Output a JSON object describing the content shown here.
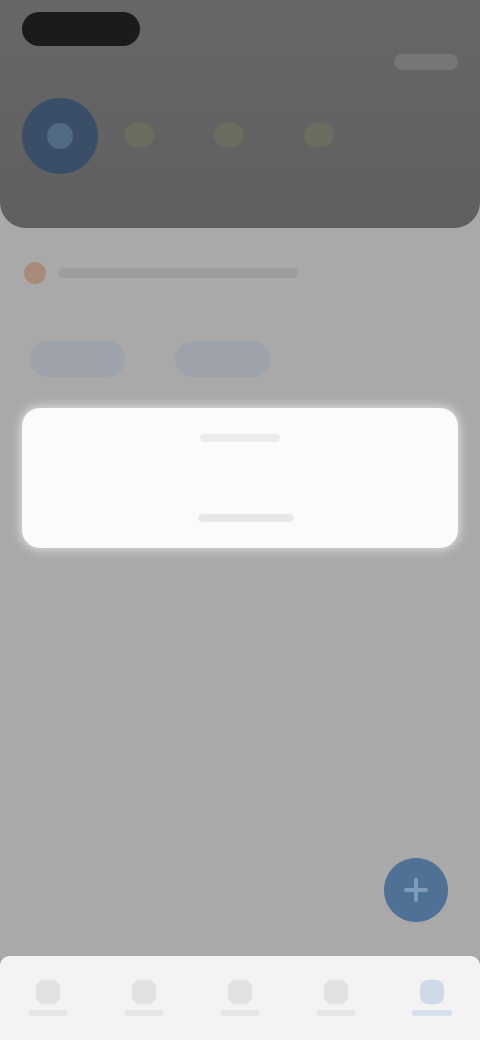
{
  "header": {
    "status_indicator": "",
    "avatar_icon": "avatar-icon"
  },
  "notice": {
    "icon": "alert-icon",
    "text": ""
  },
  "links": [
    {
      "label": ""
    },
    {
      "label": ""
    }
  ],
  "card": {
    "title": "",
    "action_label": ""
  },
  "fab": {
    "icon": "plus-icon"
  },
  "bottom_nav": {
    "items": [
      {
        "label": "",
        "icon": "home-icon"
      },
      {
        "label": "",
        "icon": "search-icon"
      },
      {
        "label": "",
        "icon": "list-icon"
      },
      {
        "label": "",
        "icon": "bell-icon"
      },
      {
        "label": "",
        "icon": "profile-icon",
        "active": true
      }
    ]
  },
  "colors": {
    "header_bg": "#676767",
    "page_bg": "#a9a9a9",
    "accent": "#4f7196",
    "card_bg": "#fbfbfb"
  }
}
